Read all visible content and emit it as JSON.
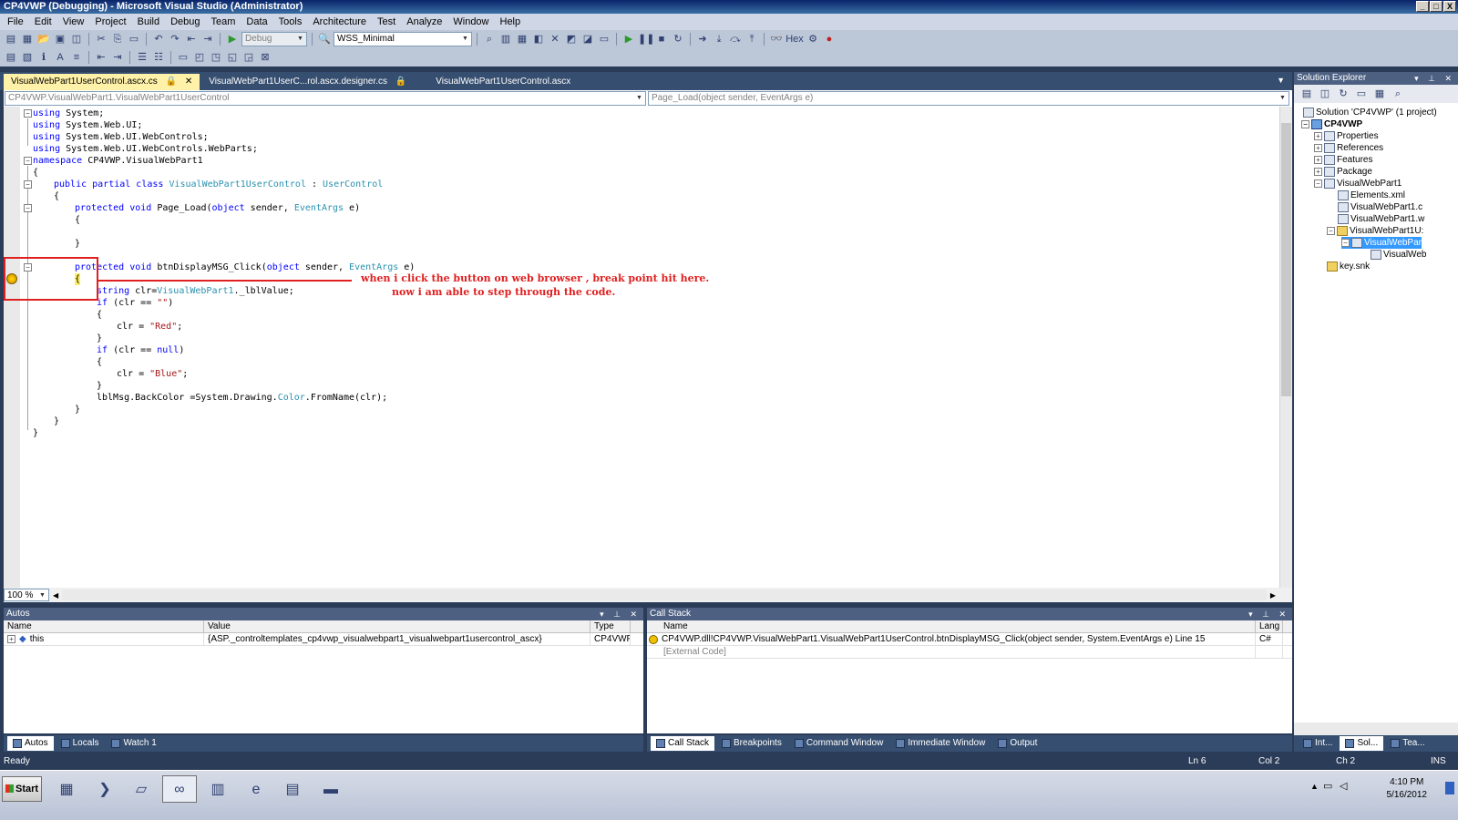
{
  "window": {
    "title": "CP4VWP (Debugging) - Microsoft Visual Studio (Administrator)",
    "controls": [
      "_",
      "□",
      "X"
    ]
  },
  "menu": [
    "File",
    "Edit",
    "View",
    "Project",
    "Build",
    "Debug",
    "Team",
    "Data",
    "Tools",
    "Architecture",
    "Test",
    "Analyze",
    "Window",
    "Help"
  ],
  "toolbar": {
    "config": "Debug",
    "platform": "WSS_Minimal",
    "hex_label": "Hex"
  },
  "editor": {
    "tabs": [
      "VisualWebPart1UserControl.ascx.cs",
      "VisualWebPart1UserC...rol.ascx.designer.cs",
      "VisualWebPart1UserControl.ascx"
    ],
    "type_nav": "CP4VWP.VisualWebPart1.VisualWebPart1UserControl",
    "member_nav": "Page_Load(object sender, EventArgs e)",
    "zoom": "100 %",
    "code": {
      "l1_kw": "using",
      "l1_rest": " System;",
      "l2_kw": "using",
      "l2_rest": " System.Web.UI;",
      "l3_kw": "using",
      "l3_rest": " System.Web.UI.WebControls;",
      "l4_kw": "using",
      "l4_rest": " System.Web.UI.WebControls.WebParts;",
      "l5_kw": "namespace",
      "l5_rest": " CP4VWP.VisualWebPart1",
      "l6": "{",
      "l7_kw": "public partial class",
      "l7_ty": "VisualWebPart1UserControl",
      "l7_mid": " : ",
      "l7_ty2": "UserControl",
      "l8": "{",
      "l9_kw": "protected void",
      "l9_a": " Page_Load(",
      "l9_kw2": "object",
      "l9_b": " sender, ",
      "l9_ty": "EventArgs",
      "l9_c": " e)",
      "l10": "{",
      "l12": "}",
      "l14_kw": "protected void",
      "l14_a": " btnDisplayMSG_Click(",
      "l14_kw2": "object",
      "l14_b": " sender, ",
      "l14_ty": "EventArgs",
      "l14_c": " e)",
      "l15": "{",
      "l16_kw": "string",
      "l16_a": " clr=",
      "l16_ty": "VisualWebPart1",
      "l16_b": "._lblValue;",
      "l17_kw": "if",
      "l17_a": " (clr == ",
      "l17_st": "\"\"",
      "l17_b": ")",
      "l18": "{",
      "l19_a": "clr = ",
      "l19_st": "\"Red\"",
      "l19_b": ";",
      "l20": "}",
      "l21_kw": "if",
      "l21_a": " (clr == ",
      "l21_kw2": "null",
      "l21_b": ")",
      "l22": "{",
      "l23_a": "clr = ",
      "l23_st": "\"Blue\"",
      "l23_b": ";",
      "l24": "}",
      "l25_a": "lblMsg.BackColor =System.Drawing.",
      "l25_ty": "Color",
      "l25_b": ".FromName(clr);",
      "l26": "}",
      "l27": "}",
      "l28": "}"
    },
    "annotation": {
      "line1": "when  i click the button on web browser , break point hit here.",
      "line2": "now i am able to step through the code."
    }
  },
  "autos": {
    "title": "Autos",
    "columns": [
      "Name",
      "Value",
      "Type"
    ],
    "rows": [
      {
        "name": "this",
        "value": "{ASP._controltemplates_cp4vwp_visualwebpart1_visualwebpart1usercontrol_ascx}",
        "type": "CP4VWP"
      }
    ],
    "tabs": [
      "Autos",
      "Locals",
      "Watch 1"
    ]
  },
  "callstack": {
    "title": "Call Stack",
    "columns": [
      "Name",
      "Lang"
    ],
    "rows": [
      {
        "name": "CP4VWP.dll!CP4VWP.VisualWebPart1.VisualWebPart1UserControl.btnDisplayMSG_Click(object sender, System.EventArgs e) Line 15",
        "lang": "C#"
      },
      {
        "name": "[External Code]",
        "lang": ""
      }
    ],
    "tabs": [
      "Call Stack",
      "Breakpoints",
      "Command Window",
      "Immediate Window",
      "Output"
    ]
  },
  "solution_explorer": {
    "title": "Solution Explorer",
    "items": [
      "Solution 'CP4VWP' (1 project)",
      "CP4VWP",
      "Properties",
      "References",
      "Features",
      "Package",
      "VisualWebPart1",
      "Elements.xml",
      "VisualWebPart1.c",
      "VisualWebPart1.w",
      "VisualWebPart1U:",
      "VisualWebPar",
      "VisualWeb",
      "key.snk"
    ],
    "tabs": [
      "Int...",
      "Sol...",
      "Tea..."
    ]
  },
  "status": {
    "ready": "Ready",
    "line": "Ln 6",
    "col": "Col 2",
    "ch": "Ch 2",
    "mode": "INS"
  },
  "taskbar": {
    "start": "Start",
    "time": "4:10 PM",
    "date": "5/16/2012"
  }
}
